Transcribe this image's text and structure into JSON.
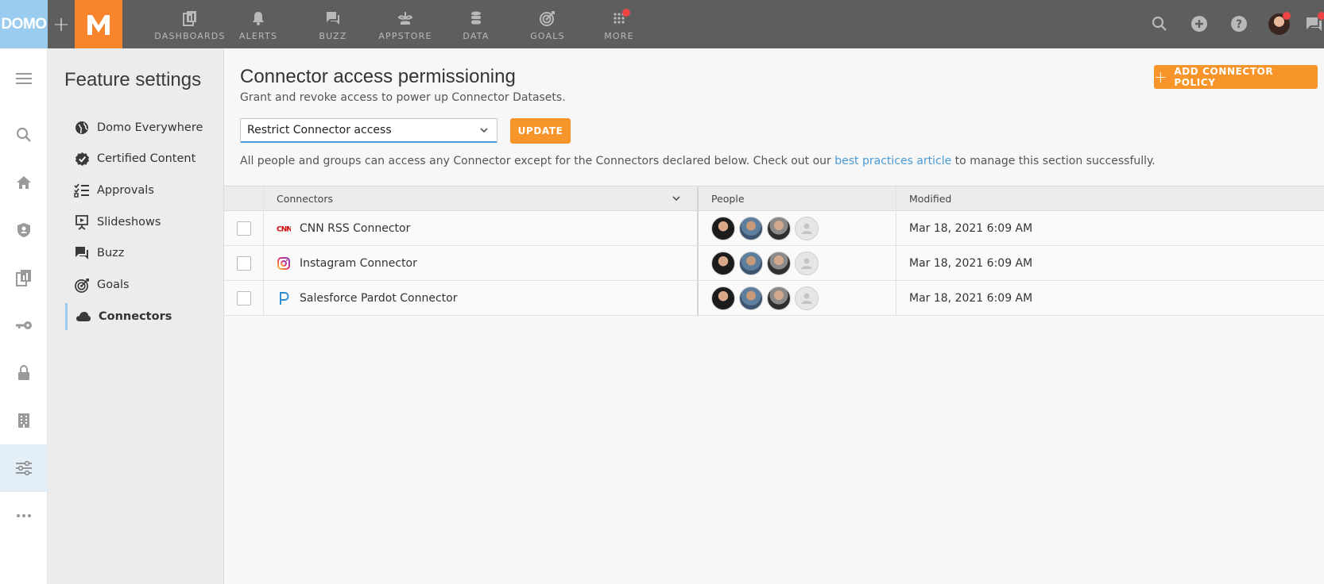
{
  "topbar": {
    "brand_label": "DOMO",
    "plus": "+",
    "nav": [
      {
        "label": "DASHBOARDS",
        "icon": "dashboards-icon"
      },
      {
        "label": "ALERTS",
        "icon": "bell-icon"
      },
      {
        "label": "BUZZ",
        "icon": "chat-icon"
      },
      {
        "label": "APPSTORE",
        "icon": "appstore-icon"
      },
      {
        "label": "DATA",
        "icon": "database-icon"
      },
      {
        "label": "GOALS",
        "icon": "target-icon"
      },
      {
        "label": "MORE",
        "icon": "grid-icon"
      }
    ],
    "notification_color": "#ee4444"
  },
  "rail": {
    "items": [
      "menu-icon",
      "search-icon",
      "home-icon",
      "shield-icon",
      "reports-icon",
      "key-icon",
      "lock-icon",
      "building-icon",
      "sliders-icon",
      "more-icon"
    ],
    "active": "sliders-icon"
  },
  "settings": {
    "title": "Feature settings",
    "items": [
      {
        "label": "Domo Everywhere",
        "icon": "globe-icon"
      },
      {
        "label": "Certified Content",
        "icon": "certified-badge-icon"
      },
      {
        "label": "Approvals",
        "icon": "checklist-icon"
      },
      {
        "label": "Slideshows",
        "icon": "presentation-icon"
      },
      {
        "label": "Buzz",
        "icon": "chat-icon"
      },
      {
        "label": "Goals",
        "icon": "target-icon"
      },
      {
        "label": "Connectors",
        "icon": "cloud-icon"
      }
    ],
    "active": "Connectors"
  },
  "main": {
    "title": "Connector access permissioning",
    "subtitle": "Grant and revoke access to power up Connector Datasets.",
    "add_button": "ADD CONNECTOR POLICY",
    "select_value": "Restrict Connector access",
    "update_button": "UPDATE",
    "info_prefix": "All people and groups can access any Connector except for the Connectors declared below. Check out our ",
    "info_link": "best practices article",
    "info_suffix": " to manage this section successfully."
  },
  "table": {
    "headers": {
      "connectors": "Connectors",
      "people": "People",
      "modified": "Modified"
    },
    "rows": [
      {
        "name": "CNN RSS Connector",
        "icon": "cnn-logo-icon",
        "modified": "Mar 18, 2021 6:09 AM"
      },
      {
        "name": "Instagram Connector",
        "icon": "instagram-logo-icon",
        "modified": "Mar 18, 2021 6:09 AM"
      },
      {
        "name": "Salesforce Pardot Connector",
        "icon": "pardot-logo-icon",
        "modified": "Mar 18, 2021 6:09 AM"
      }
    ]
  },
  "colors": {
    "accent_orange": "#f8952a",
    "domo_blue": "#99ccee",
    "link_blue": "#4a9bd6",
    "topbar_gray": "#5e5e5e"
  }
}
